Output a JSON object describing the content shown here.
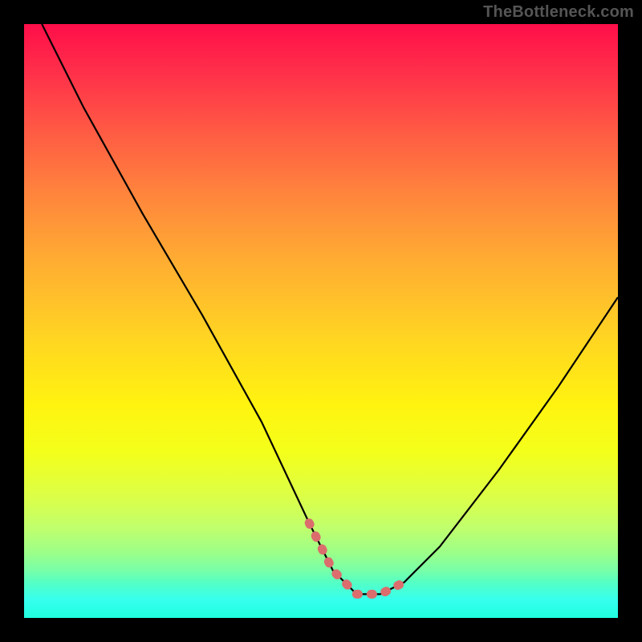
{
  "watermark": "TheBottleneck.com",
  "chart_data": {
    "type": "line",
    "title": "",
    "xlabel": "",
    "ylabel": "",
    "xlim": [
      0,
      100
    ],
    "ylim": [
      0,
      100
    ],
    "grid": false,
    "legend": false,
    "series": [
      {
        "name": "curve",
        "color": "#000000",
        "x": [
          3,
          10,
          20,
          30,
          40,
          48,
          52,
          56,
          60,
          64,
          70,
          80,
          90,
          100
        ],
        "y": [
          100,
          86,
          68,
          51,
          33,
          16,
          8,
          4,
          4,
          6,
          12,
          25,
          39,
          54
        ]
      }
    ],
    "highlight": {
      "name": "optimal-range",
      "color": "#e57373",
      "x": [
        48,
        52,
        56,
        60,
        64
      ],
      "y": [
        16,
        8,
        4,
        4,
        6
      ]
    },
    "background_gradient": {
      "direction": "vertical",
      "stops": [
        {
          "pos": 0.0,
          "color": "#ff0e49"
        },
        {
          "pos": 0.28,
          "color": "#ff823d"
        },
        {
          "pos": 0.52,
          "color": "#ffd223"
        },
        {
          "pos": 0.72,
          "color": "#f4ff1a"
        },
        {
          "pos": 0.89,
          "color": "#9cff88"
        },
        {
          "pos": 1.0,
          "color": "#20ffdf"
        }
      ]
    }
  }
}
